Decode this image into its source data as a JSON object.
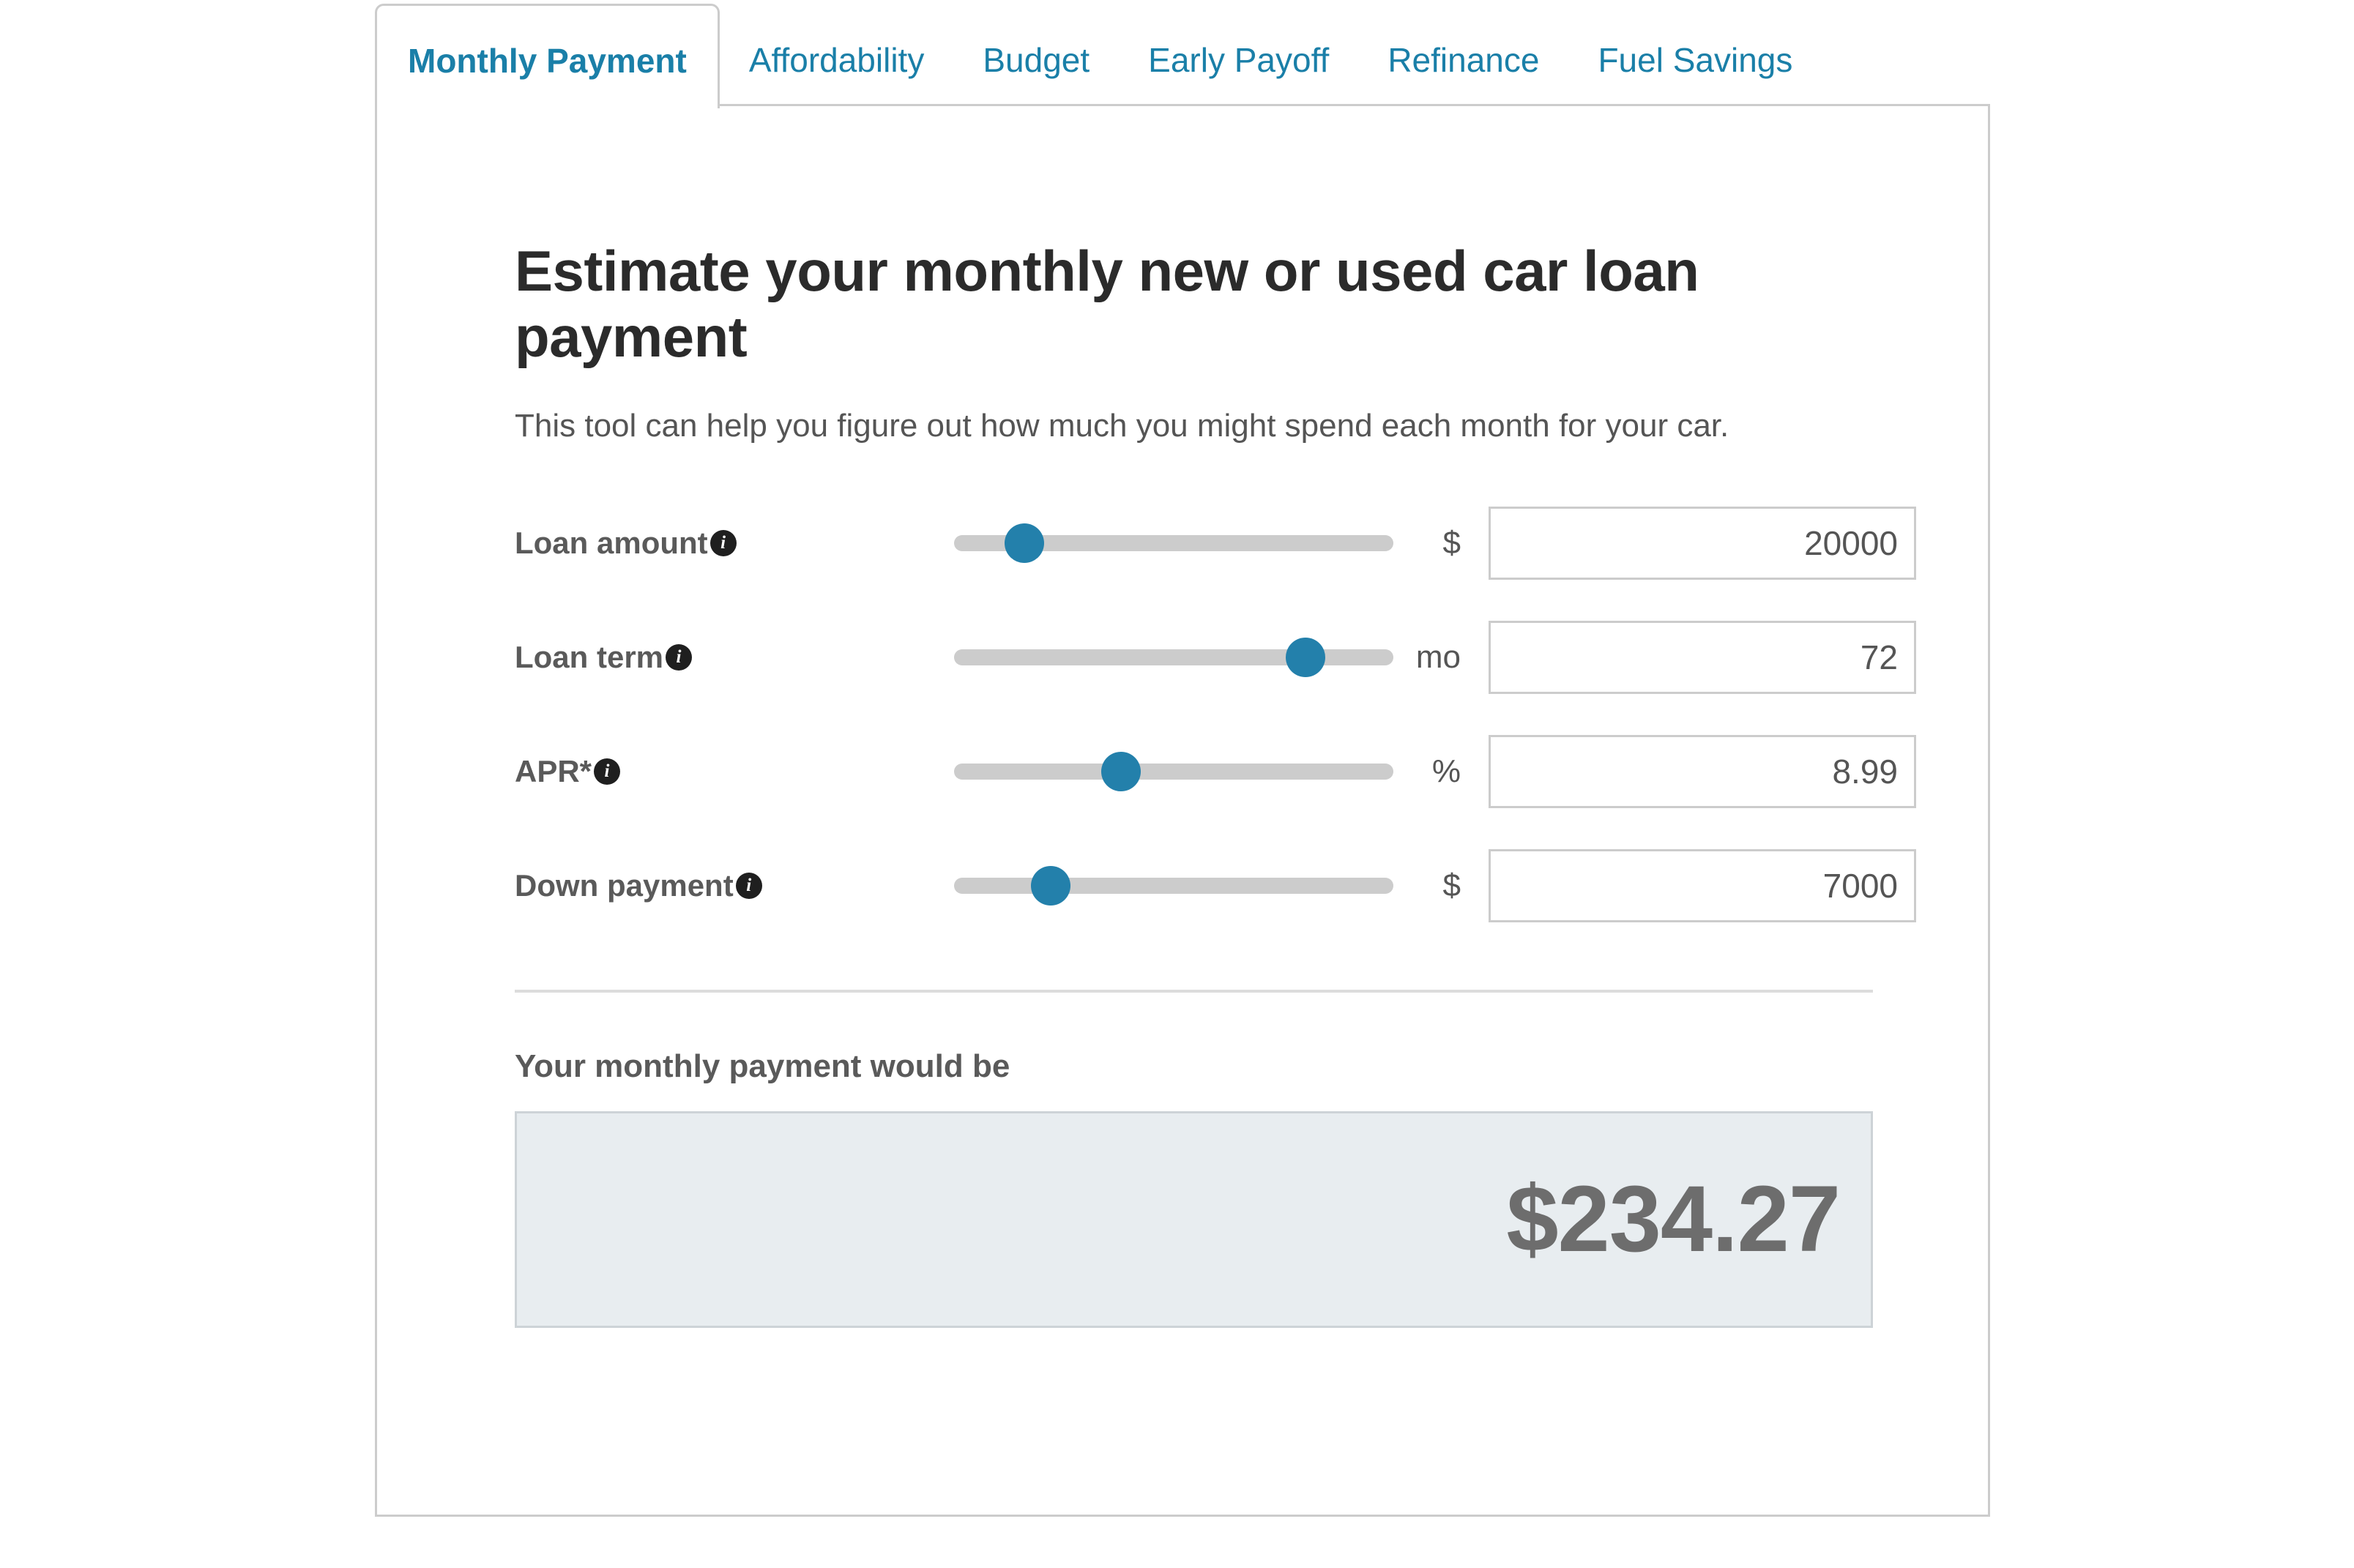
{
  "tabs": [
    {
      "label": "Monthly Payment",
      "active": true
    },
    {
      "label": "Affordability",
      "active": false
    },
    {
      "label": "Budget",
      "active": false
    },
    {
      "label": "Early Payoff",
      "active": false
    },
    {
      "label": "Refinance",
      "active": false
    },
    {
      "label": "Fuel Savings",
      "active": false
    }
  ],
  "panel": {
    "headline": "Estimate your monthly new or used car loan payment",
    "subhead": "This tool can help you figure out how much you might spend each month for your car."
  },
  "fields": [
    {
      "label": "Loan amount",
      "info_icon": "info-icon",
      "unit": "$",
      "value": "20000",
      "slider_percent": 16
    },
    {
      "label": "Loan term",
      "info_icon": "info-icon",
      "unit": "mo",
      "value": "72",
      "slider_percent": 80
    },
    {
      "label": "APR*",
      "info_icon": "info-icon",
      "unit": "%",
      "value": "8.99",
      "slider_percent": 38
    },
    {
      "label": "Down payment",
      "info_icon": "info-icon",
      "unit": "$",
      "value": "7000",
      "slider_percent": 22
    }
  ],
  "result": {
    "label": "Your monthly payment would be",
    "amount": "$234.27"
  },
  "colors": {
    "tab_link": "#1a7fa8",
    "slider_thumb": "#2380ab",
    "slider_track": "#cccccc",
    "panel_border": "#cccccc",
    "result_bg": "#e8edf0",
    "result_text": "#6d6d6d"
  }
}
